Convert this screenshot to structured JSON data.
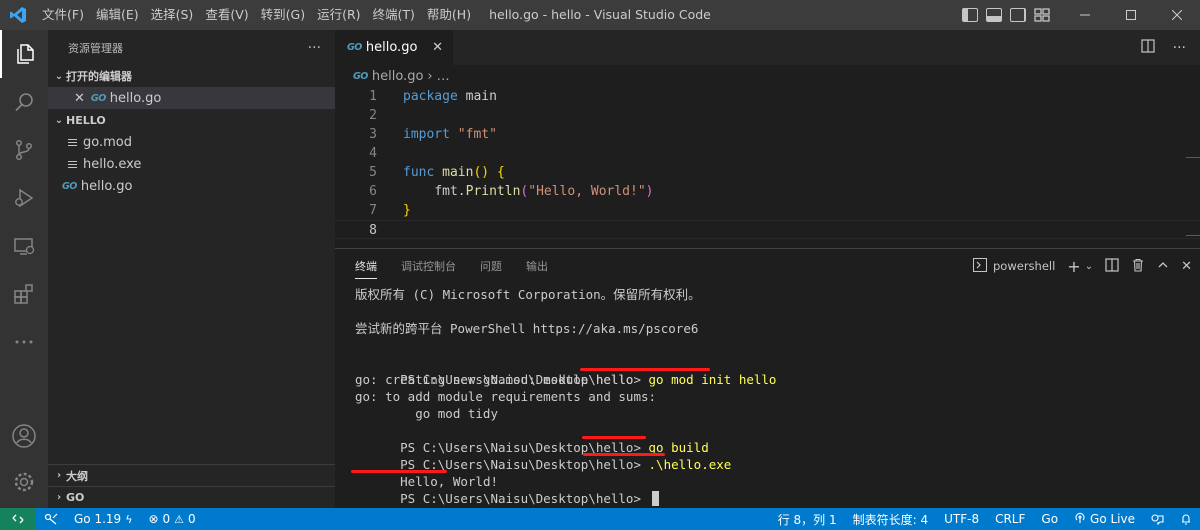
{
  "titlebar": {
    "menus": [
      "文件(F)",
      "编辑(E)",
      "选择(S)",
      "查看(V)",
      "转到(G)",
      "运行(R)",
      "终端(T)",
      "帮助(H)"
    ],
    "title": "hello.go - hello - Visual Studio Code"
  },
  "sidebar": {
    "header": "资源管理器",
    "open_editors_label": "打开的编辑器",
    "open_editor_file": "hello.go",
    "folder_label": "HELLO",
    "files": [
      "go.mod",
      "hello.exe",
      "hello.go"
    ],
    "outline_label": "大纲",
    "go_label": "GO"
  },
  "editor": {
    "tab_label": "hello.go",
    "breadcrumb_file": "hello.go",
    "breadcrumb_rest": "…",
    "line_numbers": [
      "1",
      "2",
      "3",
      "4",
      "5",
      "6",
      "7",
      "8"
    ],
    "code": {
      "l1_kw": "package",
      "l1_rest": " main",
      "l3_kw": "import",
      "l3_str": "\"fmt\"",
      "l5_kw": "func",
      "l5_fn": "main",
      "l5_paren": "()",
      "l5_brace": "{",
      "l6_pkg": "fmt.",
      "l6_fn": "Println",
      "l6_open": "(",
      "l6_str": "\"Hello, World!\"",
      "l6_close": ")",
      "l7_brace": "}"
    }
  },
  "panel": {
    "tabs": [
      "终端",
      "调试控制台",
      "问题",
      "输出"
    ],
    "shell": "powershell",
    "terminal": {
      "copyright": "版权所有 (C) Microsoft Corporation。保留所有权利。",
      "try_new": "尝试新的跨平台 PowerShell https://aka.ms/pscore6",
      "prompt": "PS C:\\Users\\Naisu\\Desktop\\hello> ",
      "cmd1": "go mod init hello",
      "out1": "go: creating new go.mod: module hello",
      "out2": "go: to add module requirements and sums:",
      "out3": "        go mod tidy",
      "cmd2": "go build",
      "cmd3": ".\\hello.exe",
      "out4": "Hello, World!"
    }
  },
  "statusbar": {
    "go_version": "Go 1.19",
    "errors": "0",
    "warnings": "0",
    "position": "行 8，列 1",
    "indent": "制表符长度: 4",
    "encoding": "UTF-8",
    "eol": "CRLF",
    "language": "Go",
    "live": "Go Live"
  },
  "colors": {
    "accent": "#007acc",
    "remote": "#16825d",
    "annotation": "#ff1a1a"
  }
}
